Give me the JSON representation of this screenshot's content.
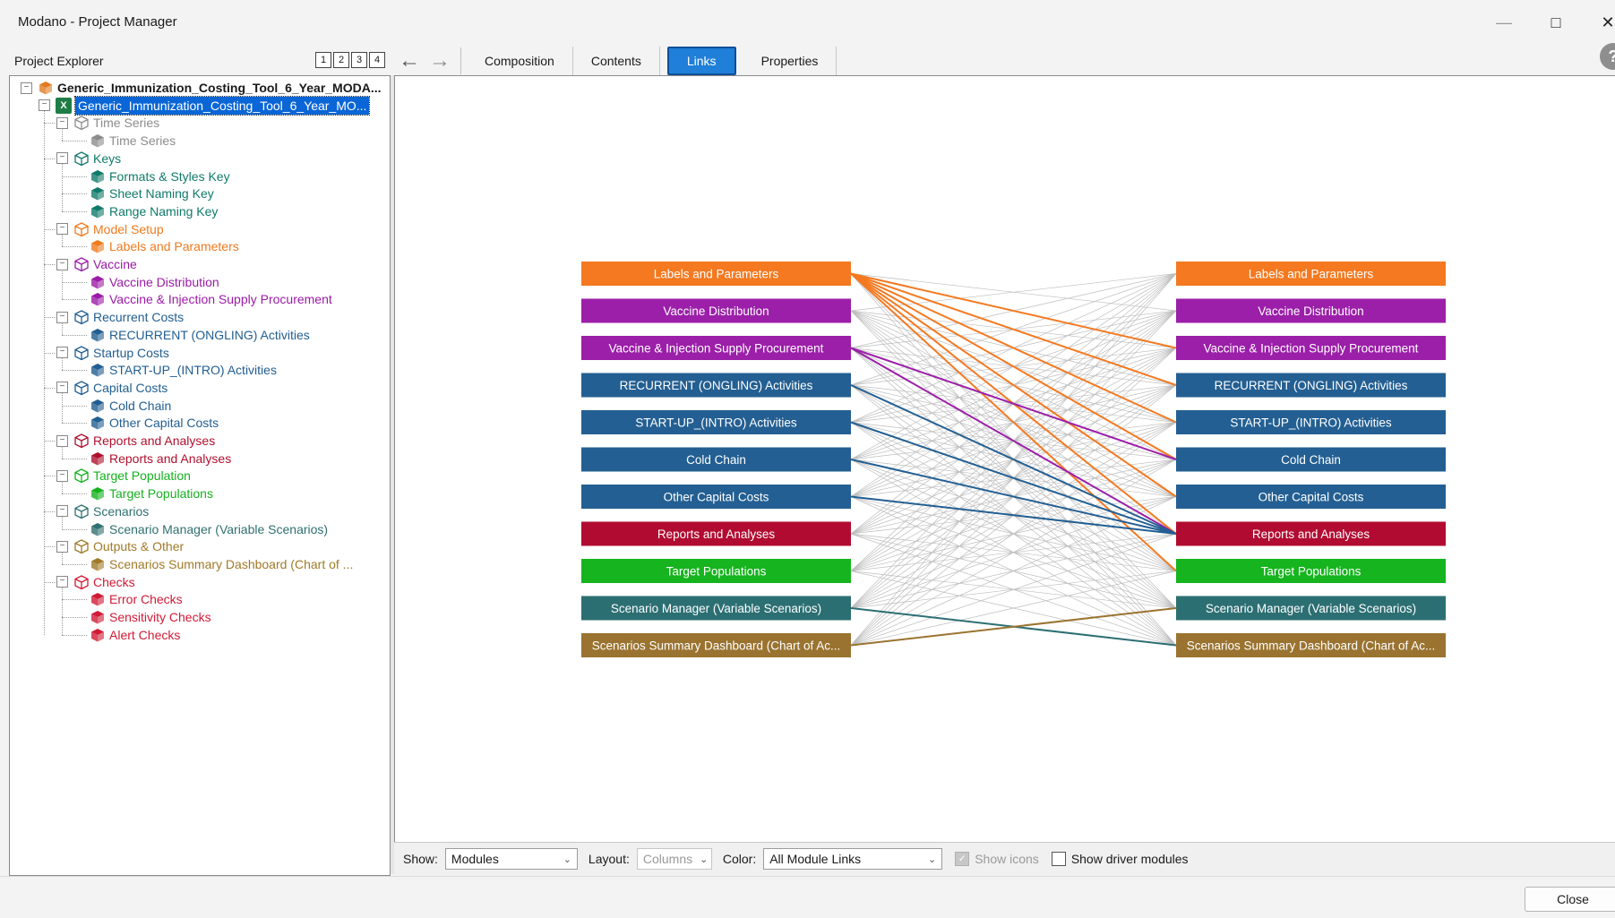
{
  "window": {
    "title": "Modano - Project Manager"
  },
  "explorer": {
    "title": "Project Explorer",
    "view_numbers": [
      "1",
      "2",
      "3",
      "4"
    ]
  },
  "toolbar": {
    "tabs": [
      "Composition",
      "Contents",
      "Links",
      "Properties"
    ],
    "active_tab": "Links"
  },
  "tree": {
    "root": {
      "label": "Generic_Immunization_Costing_Tool_6_Year_MODA...",
      "icon": "project-cube-icon",
      "color": "#e07a1f"
    },
    "workbook": {
      "label": "Generic_Immunization_Costing_Tool_6_Year_MO...",
      "icon": "excel-icon"
    },
    "groups": [
      {
        "label": "Time Series",
        "color": "#8c8c8c",
        "items": [
          "Time Series"
        ]
      },
      {
        "label": "Keys",
        "color": "#0f7a6a",
        "items": [
          "Formats & Styles Key",
          "Sheet Naming Key",
          "Range Naming Key"
        ]
      },
      {
        "label": "Model Setup",
        "color": "#f07a1e",
        "items": [
          "Labels and Parameters"
        ]
      },
      {
        "label": "Vaccine",
        "color": "#9b1aa6",
        "items": [
          "Vaccine Distribution",
          "Vaccine & Injection Supply Procurement"
        ]
      },
      {
        "label": "Recurrent Costs",
        "color": "#215e91",
        "items": [
          "RECURRENT (ONGLING) Activities"
        ]
      },
      {
        "label": "Startup Costs",
        "color": "#215e91",
        "items": [
          "START-UP_(INTRO) Activities"
        ]
      },
      {
        "label": "Capital Costs",
        "color": "#215e91",
        "items": [
          "Cold Chain",
          "Other Capital Costs"
        ]
      },
      {
        "label": "Reports and Analyses",
        "color": "#b0102e",
        "items": [
          "Reports and Analyses"
        ]
      },
      {
        "label": "Target Population",
        "color": "#14b21e",
        "items": [
          "Target Populations"
        ]
      },
      {
        "label": "Scenarios",
        "color": "#2f7070",
        "items": [
          "Scenario Manager (Variable Scenarios)"
        ]
      },
      {
        "label": "Outputs & Other",
        "color": "#a07a28",
        "items": [
          "Scenarios Summary Dashboard (Chart of ..."
        ]
      },
      {
        "label": "Checks",
        "color": "#d11a36",
        "items": [
          "Error Checks",
          "Sensitivity Checks",
          "Alert Checks"
        ]
      }
    ]
  },
  "links": {
    "modules": [
      {
        "label": "Labels and Parameters",
        "color": "#f47920"
      },
      {
        "label": "Vaccine Distribution",
        "color": "#9b1fa8"
      },
      {
        "label": "Vaccine & Injection Supply Procurement",
        "color": "#9b1fa8"
      },
      {
        "label": "RECURRENT (ONGLING) Activities",
        "color": "#235f92"
      },
      {
        "label": "START-UP_(INTRO) Activities",
        "color": "#235f92"
      },
      {
        "label": "Cold Chain",
        "color": "#235f92"
      },
      {
        "label": "Other Capital Costs",
        "color": "#235f92"
      },
      {
        "label": "Reports and Analyses",
        "color": "#b20b31"
      },
      {
        "label": "Target Populations",
        "color": "#16b41e"
      },
      {
        "label": "Scenario Manager (Variable Scenarios)",
        "color": "#2c6f73"
      },
      {
        "label": "Scenarios Summary Dashboard (Chart of Ac...",
        "color": "#9a7330"
      }
    ],
    "highlighted_links": [
      [
        0,
        2
      ],
      [
        0,
        3
      ],
      [
        0,
        4
      ],
      [
        0,
        5
      ],
      [
        0,
        6
      ],
      [
        0,
        7
      ],
      [
        0,
        8
      ],
      [
        2,
        5
      ],
      [
        2,
        7
      ],
      [
        3,
        7
      ],
      [
        4,
        7
      ],
      [
        5,
        7
      ],
      [
        6,
        7
      ],
      [
        9,
        10
      ],
      [
        10,
        9
      ]
    ]
  },
  "bottom": {
    "show_label": "Show:",
    "show_value": "Modules",
    "layout_label": "Layout:",
    "layout_value": "Columns",
    "color_label": "Color:",
    "color_value": "All Module Links",
    "show_icons_label": "Show icons",
    "show_icons_checked": true,
    "driver_label": "Show driver modules",
    "driver_checked": false
  },
  "footer": {
    "close_label": "Close"
  }
}
